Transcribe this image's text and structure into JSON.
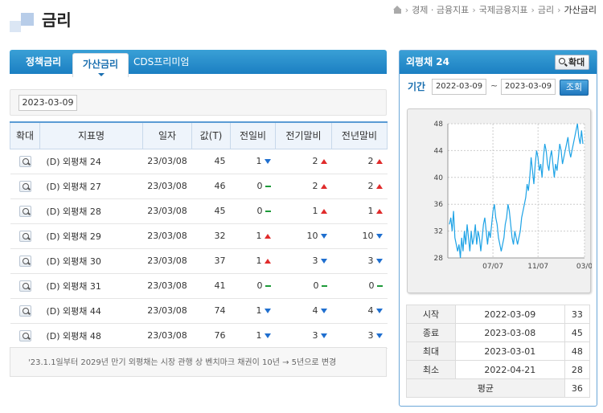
{
  "header": {
    "title": "금리",
    "breadcrumb": [
      "경제 · 금융지표",
      "국제금융지표",
      "금리",
      "가산금리"
    ]
  },
  "tabs": [
    {
      "label": "정책금리"
    },
    {
      "label": "가산금리"
    },
    {
      "label": "CDS프리미엄"
    }
  ],
  "date": "2023-03-09",
  "table": {
    "headers": [
      "확대",
      "지표명",
      "일자",
      "값(T)",
      "전일비",
      "전기말비",
      "전년말비"
    ],
    "rows": [
      {
        "name": "(D) 외평채 24",
        "date": "23/03/08",
        "value": "45",
        "d1": "1",
        "d1dir": "dn",
        "d2": "2",
        "d2dir": "up",
        "d3": "2",
        "d3dir": "up"
      },
      {
        "name": "(D) 외평채 27",
        "date": "23/03/08",
        "value": "46",
        "d1": "0",
        "d1dir": "eq",
        "d2": "2",
        "d2dir": "up",
        "d3": "2",
        "d3dir": "up"
      },
      {
        "name": "(D) 외평채 28",
        "date": "23/03/08",
        "value": "45",
        "d1": "0",
        "d1dir": "eq",
        "d2": "1",
        "d2dir": "up",
        "d3": "1",
        "d3dir": "up"
      },
      {
        "name": "(D) 외평채 29",
        "date": "23/03/08",
        "value": "32",
        "d1": "1",
        "d1dir": "up",
        "d2": "10",
        "d2dir": "dn",
        "d3": "10",
        "d3dir": "dn"
      },
      {
        "name": "(D) 외평채 30",
        "date": "23/03/08",
        "value": "37",
        "d1": "1",
        "d1dir": "up",
        "d2": "3",
        "d2dir": "dn",
        "d3": "3",
        "d3dir": "dn"
      },
      {
        "name": "(D) 외평채 31",
        "date": "23/03/08",
        "value": "41",
        "d1": "0",
        "d1dir": "eq",
        "d2": "0",
        "d2dir": "eq",
        "d3": "0",
        "d3dir": "eq"
      },
      {
        "name": "(D) 외평채 44",
        "date": "23/03/08",
        "value": "74",
        "d1": "1",
        "d1dir": "dn",
        "d2": "4",
        "d2dir": "dn",
        "d3": "4",
        "d3dir": "dn"
      },
      {
        "name": "(D) 외평채 48",
        "date": "23/03/08",
        "value": "76",
        "d1": "1",
        "d1dir": "dn",
        "d2": "3",
        "d2dir": "dn",
        "d3": "3",
        "d3dir": "dn"
      }
    ]
  },
  "note": "'23.1.1일부터 2029년 만기 외평채는 시장 관행 상 벤치마크 채권이 10년 → 5년으로 변경",
  "panel": {
    "title": "외평채 24",
    "zoom_label": "확대",
    "period_label": "기간",
    "start_date": "2022-03-09",
    "end_date": "2023-03-09",
    "query_label": "조회"
  },
  "stats": [
    {
      "label": "시작",
      "date": "2022-03-09",
      "value": "33"
    },
    {
      "label": "종료",
      "date": "2023-03-08",
      "value": "45"
    },
    {
      "label": "최대",
      "date": "2023-03-01",
      "value": "48"
    },
    {
      "label": "최소",
      "date": "2022-04-21",
      "value": "28"
    }
  ],
  "avg": {
    "label": "평균",
    "value": "36"
  },
  "colors": {
    "line": "#1ea3e6",
    "up": "#e02b2b",
    "down": "#1f6fcf",
    "flat": "#1e9a3a"
  },
  "chart_data": {
    "type": "line",
    "title": "",
    "xlabel": "",
    "ylabel": "",
    "ylim": [
      28,
      48
    ],
    "yticks": [
      28,
      32,
      36,
      40,
      44,
      48
    ],
    "xtick_labels": [
      "07/07",
      "11/07",
      "03/0"
    ],
    "x_start": "2022-03-09",
    "x_end": "2023-03-09",
    "grid": true,
    "series": [
      {
        "values": [
          33,
          34,
          32,
          35,
          31,
          30,
          29,
          30,
          28,
          31,
          29,
          32,
          30,
          33,
          31,
          29,
          32,
          30,
          31,
          33,
          30,
          32,
          31,
          29,
          31,
          33,
          34,
          32,
          30,
          32,
          31,
          33,
          35,
          36,
          34,
          33,
          31,
          30,
          29,
          30,
          31,
          33,
          34,
          36,
          35,
          33,
          31,
          30,
          32,
          31,
          30,
          31,
          32,
          34,
          35,
          36,
          37,
          39,
          38,
          40,
          43,
          41,
          39,
          42,
          44,
          43,
          41,
          42,
          40,
          43,
          45,
          44,
          42,
          41,
          43,
          44,
          42,
          40,
          42,
          41,
          43,
          45,
          44,
          42,
          43,
          44,
          45,
          46,
          44,
          43,
          44,
          45,
          46,
          47,
          48,
          46,
          45,
          47,
          45
        ]
      }
    ]
  }
}
